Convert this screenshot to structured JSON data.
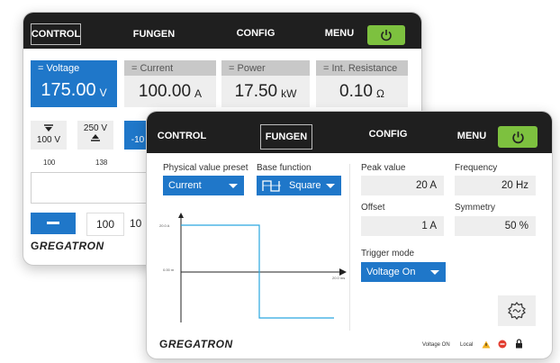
{
  "back": {
    "tabs": [
      "CONTROL",
      "FUNGEN",
      "CONFIG",
      "MENU"
    ],
    "cards": [
      {
        "label": "Voltage",
        "value": "175.00",
        "unit": "V"
      },
      {
        "label": "Current",
        "value": "100.00",
        "unit": "A"
      },
      {
        "label": "Power",
        "value": "17.50",
        "unit": "kW"
      },
      {
        "label": "Int. Resistance",
        "value": "0.10",
        "unit": "Ω"
      }
    ],
    "preset1": "100 V",
    "preset2": "250 V",
    "preset3": "-10",
    "scale": [
      "100",
      "138"
    ],
    "stepper_value1": "100",
    "stepper_value2": "10",
    "logo": "REGATRON"
  },
  "front": {
    "tabs": [
      "CONTROL",
      "FUNGEN",
      "CONFIG",
      "MENU"
    ],
    "preset_label": "Physical value preset",
    "preset_value": "Current",
    "basefn_label": "Base function",
    "basefn_value": "Square",
    "peak_label": "Peak value",
    "peak_value": "20 A",
    "freq_label": "Frequency",
    "freq_value": "20 Hz",
    "offset_label": "Offset",
    "offset_value": "1 A",
    "sym_label": "Symmetry",
    "sym_value": "50 %",
    "trigger_label": "Trigger mode",
    "trigger_value": "Voltage On",
    "graph_labels": {
      "top": "20.0 A",
      "mid": "0.00 m",
      "right": "20.0 ms"
    },
    "status": [
      "Voltage ON",
      "Local"
    ],
    "logo": "REGATRON"
  },
  "colors": {
    "accent": "#1f77c9",
    "power": "#7dc13f",
    "topbar": "#1f1f1f",
    "wave": "#2aa8e0"
  }
}
